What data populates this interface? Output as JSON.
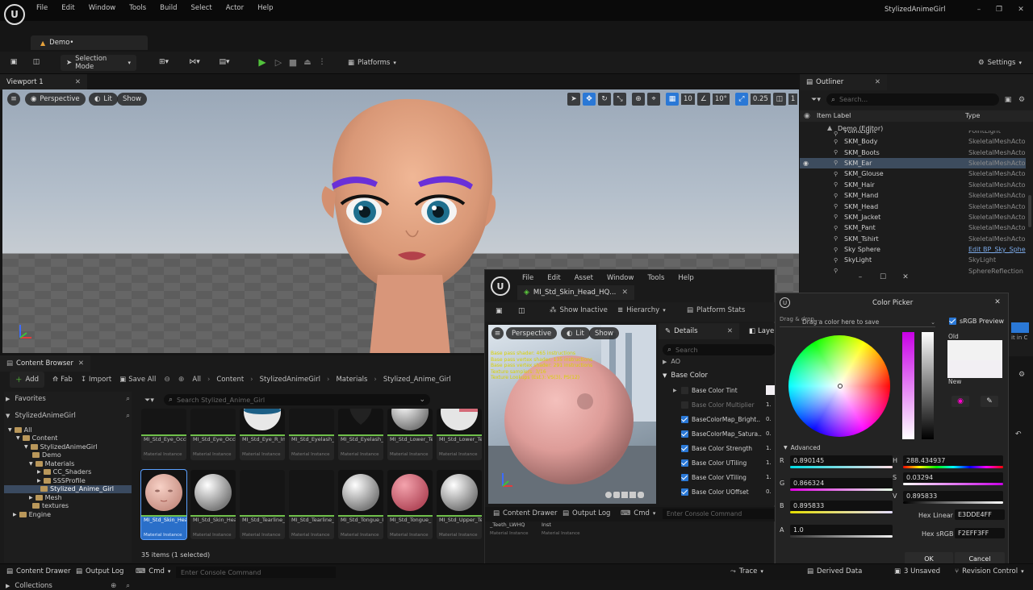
{
  "title_bar": {
    "project": "StylizedAnimeGirl",
    "level_tab": "Demo•"
  },
  "menu": [
    "File",
    "Edit",
    "Window",
    "Tools",
    "Build",
    "Select",
    "Actor",
    "Help"
  ],
  "toolbar": {
    "selection_mode": "Selection Mode",
    "platforms": "Platforms",
    "settings": "Settings"
  },
  "viewport": {
    "tab": "Viewport 1",
    "perspective": "Perspective",
    "lit": "Lit",
    "show": "Show",
    "grid_snap": "10",
    "rot_snap": "10°",
    "scale_snap": "0.25",
    "cam_speed": "1"
  },
  "outliner": {
    "tab": "Outliner",
    "search_placeholder": "Search...",
    "col_label": "Item Label",
    "col_type": "Type",
    "root": "Demo (Editor)",
    "items": [
      {
        "name": "PointLight",
        "type": "PointLight"
      },
      {
        "name": "SKM_Body",
        "type": "SkeletalMeshActo"
      },
      {
        "name": "SKM_Boots",
        "type": "SkeletalMeshActo"
      },
      {
        "name": "SKM_Ear",
        "type": "SkeletalMeshActo"
      },
      {
        "name": "SKM_Glouse",
        "type": "SkeletalMeshActo"
      },
      {
        "name": "SKM_Hair",
        "type": "SkeletalMeshActo"
      },
      {
        "name": "SKM_Hand",
        "type": "SkeletalMeshActo"
      },
      {
        "name": "SKM_Head",
        "type": "SkeletalMeshActo"
      },
      {
        "name": "SKM_Jacket",
        "type": "SkeletalMeshActo"
      },
      {
        "name": "SKM_Pant",
        "type": "SkeletalMeshActo"
      },
      {
        "name": "SKM_Tshirt",
        "type": "SkeletalMeshActo"
      },
      {
        "name": "Sky Sphere",
        "type": "Edit BP_Sky_Sphe"
      },
      {
        "name": "SkyLight",
        "type": "SkyLight"
      },
      {
        "name": "",
        "type": "SphereReflection"
      }
    ]
  },
  "content_browser": {
    "tab": "Content Browser",
    "add": "Add",
    "fab": "Fab",
    "import": "Import",
    "save_all": "Save All",
    "breadcrumb": [
      "All",
      "Content",
      "StylizedAnimeGirl",
      "Materials",
      "Stylized_Anime_Girl"
    ],
    "favorites": "Favorites",
    "project_root": "StylizedAnimeGirl",
    "search_placeholder": "Search Stylized_Anime_Girl",
    "tree": [
      "All",
      "Content",
      "StylizedAnimeGirl",
      "Demo",
      "Materials",
      "CC_Shaders",
      "SSSProfile",
      "Stylized_Anime_Girl",
      "Mesh",
      "textures",
      "Engine"
    ],
    "collections": "Collections",
    "count": "35 items (1 selected)",
    "assets_row1": [
      {
        "name": "MI_Std_Eye_Occlusion_L_Inst",
        "kind": "Material Instance",
        "thumb": "dark"
      },
      {
        "name": "MI_Std_Eye_Occlusion_R_Inst",
        "kind": "Material Instance",
        "thumb": "dark"
      },
      {
        "name": "MI_Std_Eye_R_Inst",
        "kind": "Material Instance",
        "thumb": "eye"
      },
      {
        "name": "MI_Std_Eyelash_Inst",
        "kind": "Material Instance",
        "thumb": "dark"
      },
      {
        "name": "MI_Std_Eyelash_",
        "kind": "Material Instance",
        "thumb": "heart"
      },
      {
        "name": "MI_Std_Lower_Teeth_Inst",
        "kind": "Material Instance",
        "thumb": "white"
      },
      {
        "name": "MI_Std_Lower_Teeth_LWHQ",
        "kind": "Material Instance",
        "thumb": "whitepink"
      }
    ],
    "assets_row2": [
      {
        "name": "MI_Std_Skin_Head_HQ_Inst",
        "kind": "Material Instance",
        "thumb": "face"
      },
      {
        "name": "MI_Std_Skin_Head_Inst",
        "kind": "Material Instance",
        "thumb": "white"
      },
      {
        "name": "MI_Std_Tearline_L_",
        "kind": "Material Instance",
        "thumb": "dark"
      },
      {
        "name": "MI_Std_Tearline_R_",
        "kind": "Material Instance",
        "thumb": "dark"
      },
      {
        "name": "MI_Std_Tongue_Inst",
        "kind": "Material Instance",
        "thumb": "white"
      },
      {
        "name": "MI_Std_Tongue_",
        "kind": "Material Instance",
        "thumb": "pink"
      },
      {
        "name": "MI_Std_Upper_Teeth_Inst",
        "kind": "Material Instance",
        "thumb": "white"
      }
    ],
    "behind_assets": [
      {
        "name": "_Teeth_LWHQ",
        "kind": "Material Instance"
      },
      {
        "name": "Inst",
        "kind": "Material Instance"
      }
    ]
  },
  "material_editor": {
    "menu": [
      "File",
      "Edit",
      "Asset",
      "Window",
      "Tools",
      "Help"
    ],
    "tab": "MI_Std_Skin_Head_HQ...",
    "show_inactive": "Show Inactive",
    "hierarchy": "Hierarchy",
    "platform_stats": "Platform Stats",
    "perspective": "Perspective",
    "lit": "Lit",
    "show": "Show",
    "stats": [
      "Base pass shader: 465 instructions",
      "Base pass vertex shader: 135 instructions",
      "Base pass vertex shader: 291 instructions",
      "Texture samplers: 3/16",
      "Texture Lookups (Est.): VS(3), PS(12)"
    ],
    "details_tab": "Details",
    "layers_tab": "Laye",
    "search_placeholder": "Search",
    "ao": "AO",
    "section": "Base Color",
    "params": [
      {
        "name": "Base Color Tint",
        "checked": false,
        "value": ""
      },
      {
        "name": "Base Color Multiplier",
        "checked": false,
        "value": "1."
      },
      {
        "name": "BaseColorMap_Bright..",
        "checked": true,
        "value": "0."
      },
      {
        "name": "BaseColorMap_Satura..",
        "checked": true,
        "value": "0."
      },
      {
        "name": "Base Color Strength",
        "checked": true,
        "value": "1."
      },
      {
        "name": "Base Color UTiling",
        "checked": true,
        "value": "1."
      },
      {
        "name": "Base Color VTiling",
        "checked": true,
        "value": "1."
      },
      {
        "name": "Base Color UOffset",
        "checked": true,
        "value": "0."
      }
    ],
    "bottom": {
      "content_drawer": "Content Drawer",
      "output_log": "Output Log",
      "cmd": "Cmd",
      "console_placeholder": "Enter Console Command"
    }
  },
  "color_picker": {
    "title": "Color Picker",
    "drag_hint": "Drag a color here to save",
    "drag_hint_back": "Drag & drop...",
    "srgb_preview": "sRGB Preview",
    "old": "Old",
    "new": "New",
    "advanced": "Advanced",
    "r": "0.890145",
    "g": "0.866324",
    "b": "0.895833",
    "a": "1.0",
    "h": "288.434937",
    "s": "0.03294",
    "v": "0.895833",
    "hex_linear_label": "Hex Linear",
    "hex_linear": "E3DDE4FF",
    "hex_srgb_label": "Hex sRGB",
    "hex_srgb": "F2EFF3FF",
    "ok": "OK",
    "cancel": "Cancel",
    "old_color": "#f2f2f2",
    "new_color": "#f2eff3"
  },
  "right_partial": {
    "edit_text": "it in C"
  },
  "status": {
    "content_drawer": "Content Drawer",
    "output_log": "Output Log",
    "cmd": "Cmd",
    "console_placeholder": "Enter Console Command",
    "trace": "Trace",
    "derived_data": "Derived Data",
    "unsaved": "3 Unsaved",
    "revision": "Revision Control"
  }
}
